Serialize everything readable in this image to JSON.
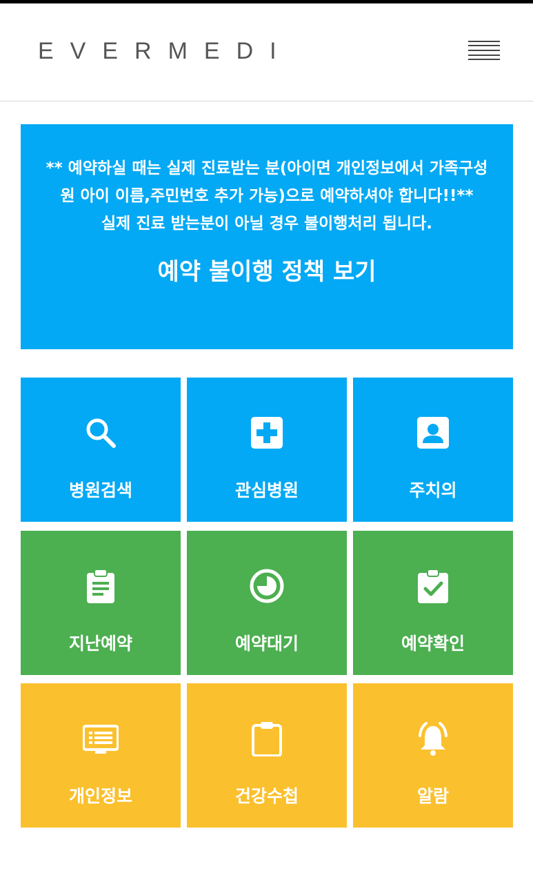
{
  "header": {
    "logo": "EVERMEDI",
    "menu_icon": "hamburger-menu-icon"
  },
  "notice": {
    "line1": "** 예약하실 때는 실제 진료받는 분(아이면 개인정보에서 가족구성원 아이 이름,주민번호 추가 가능)으로 예약하셔야 합니다!!**",
    "line2": "실제 진료 받는분이 아닐 경우 불이행처리 됩니다.",
    "policy_link": "예약 불이행 정책 보기",
    "color": "#03a9f4"
  },
  "tiles": [
    {
      "label": "병원검색",
      "icon": "search-icon",
      "color": "#03a9f4"
    },
    {
      "label": "관심병원",
      "icon": "medical-plus-icon",
      "color": "#03a9f4"
    },
    {
      "label": "주치의",
      "icon": "doctor-profile-icon",
      "color": "#03a9f4"
    },
    {
      "label": "지난예약",
      "icon": "clipboard-list-icon",
      "color": "#4caf50"
    },
    {
      "label": "예약대기",
      "icon": "clock-timer-icon",
      "color": "#4caf50"
    },
    {
      "label": "예약확인",
      "icon": "clipboard-check-icon",
      "color": "#4caf50"
    },
    {
      "label": "개인정보",
      "icon": "id-card-icon",
      "color": "#fbc02d"
    },
    {
      "label": "건강수첩",
      "icon": "clipboard-icon",
      "color": "#fbc02d"
    },
    {
      "label": "알람",
      "icon": "alarm-bell-icon",
      "color": "#fbc02d"
    }
  ]
}
